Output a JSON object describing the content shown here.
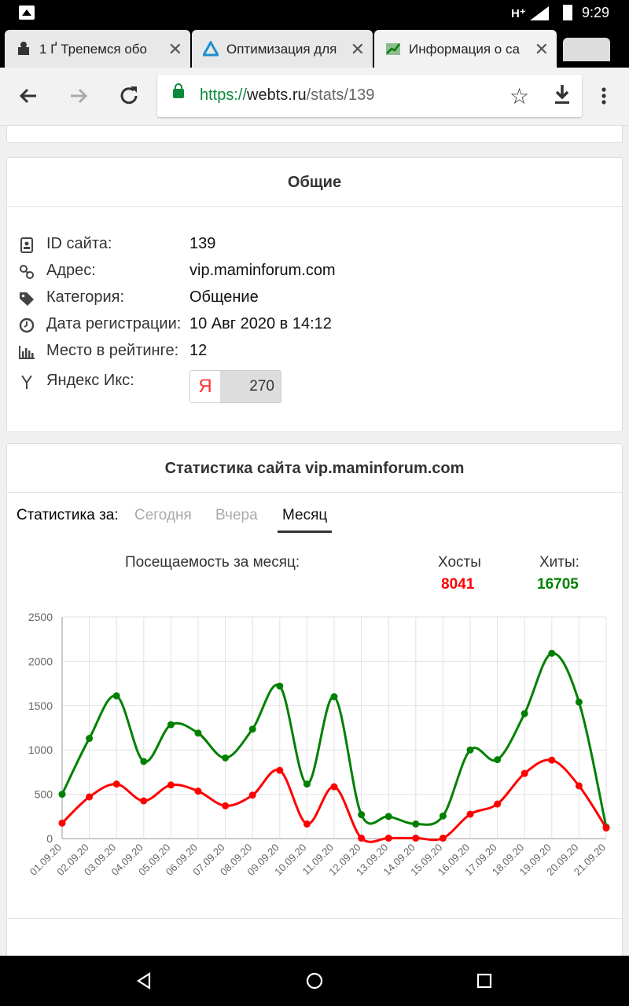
{
  "status_bar": {
    "network": "H⁺",
    "time": "9:29",
    "icons": [
      "image-icon",
      "signal-icon",
      "battery-icon"
    ]
  },
  "tabs": [
    {
      "title": "1 Ґ Трепемся обо",
      "icon": "forum-favicon",
      "active": false
    },
    {
      "title": "Оптимизация для",
      "icon": "triangle-favicon",
      "active": false
    },
    {
      "title": "Информация о са",
      "icon": "chart-favicon",
      "active": true
    }
  ],
  "toolbar": {
    "back_icon": "arrow-left-icon",
    "forward_icon": "arrow-right-icon",
    "reload_icon": "reload-icon",
    "url_scheme": "https://",
    "url_host": "webts.ru",
    "url_path": "/stats/139",
    "bookmark_icon": "star-icon",
    "download_icon": "download-icon",
    "menu_icon": "more-vert-icon"
  },
  "general": {
    "title": "Общие",
    "rows": [
      {
        "label": "ID сайта:",
        "value": "139",
        "icon": "id-badge-icon"
      },
      {
        "label": "Адрес:",
        "value": "vip.maminforum.com",
        "icon": "link-icon"
      },
      {
        "label": "Категория:",
        "value": "Общение",
        "icon": "tag-icon"
      },
      {
        "label": "Дата регистрации:",
        "value": "10 Авг 2020 в 14:12",
        "icon": "clock-icon"
      },
      {
        "label": "Место в рейтинге:",
        "value": "12",
        "icon": "bar-chart-icon"
      }
    ],
    "yandex": {
      "label": "Яндекс Икс:",
      "logo": "Я",
      "value": "270",
      "icon": "yandex-y-icon"
    }
  },
  "stats": {
    "title": "Статистика сайта vip.maminforum.com",
    "period_label": "Статистика за:",
    "periods": [
      "Сегодня",
      "Вчера",
      "Месяц"
    ],
    "active_period": "Месяц",
    "chart_caption": "Посещаемость за месяц:",
    "hosts_label": "Хосты",
    "hosts_value": "8041",
    "hits_label": "Хиты:",
    "hits_value": "16705"
  },
  "colors": {
    "hosts": "#ff0000",
    "hits": "#008000",
    "secure": "#0a8a3a"
  },
  "chart_data": {
    "type": "line",
    "x": [
      "01.09.20",
      "02.09.20",
      "03.09.20",
      "04.09.20",
      "05.09.20",
      "06.09.20",
      "07.09.20",
      "08.09.20",
      "09.09.20",
      "10.09.20",
      "11.09.20",
      "12.09.20",
      "13.09.20",
      "14.09.20",
      "15.09.20",
      "16.09.20",
      "17.09.20",
      "18.09.20",
      "19.09.20",
      "20.09.20",
      "21.09.20"
    ],
    "series": [
      {
        "name": "Хиты:",
        "color": "#008000",
        "values": [
          500,
          1130,
          1610,
          870,
          1285,
          1190,
          910,
          1235,
          1720,
          615,
          1600,
          270,
          250,
          165,
          255,
          1000,
          890,
          1410,
          2090,
          1540,
          130
        ]
      },
      {
        "name": "Хосты",
        "color": "#ff0000",
        "values": [
          175,
          470,
          615,
          425,
          605,
          535,
          370,
          490,
          770,
          165,
          585,
          5,
          5,
          5,
          5,
          275,
          390,
          735,
          885,
          595,
          120
        ]
      }
    ],
    "ylim": [
      0,
      2500
    ],
    "yticks": [
      0,
      500,
      1000,
      1500,
      2000,
      2500
    ],
    "grid": true
  },
  "nav_bar": {
    "icons": [
      "back-triangle-icon",
      "home-circle-icon",
      "recents-square-icon"
    ]
  }
}
